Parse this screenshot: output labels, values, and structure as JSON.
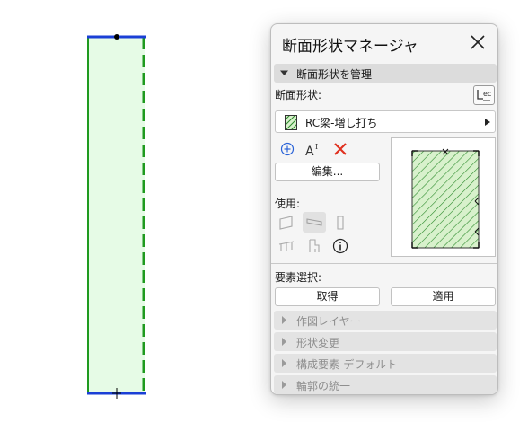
{
  "palette": {
    "title": "断面形状マネージャ",
    "sections": {
      "manage": "断面形状を管理",
      "layer": "作図レイヤー",
      "modify": "形状変更",
      "components": "構成要素-デフォルト",
      "outline": "輪郭の統一"
    },
    "profile_label": "断面形状:",
    "selected_profile": "RC梁-増し打ち",
    "edit_button": "編集...",
    "use_label": "使用:",
    "element_select_label": "要素選択:",
    "get_button": "取得",
    "apply_button": "適用"
  },
  "colors": {
    "accent_blue": "#1a3fd6",
    "green_line": "#1f9a1f",
    "fill_green": "#e6fbe6",
    "delete_red": "#e0301e"
  },
  "icons": [
    "close-icon",
    "browse-profiles-icon",
    "add-icon",
    "text-style-icon",
    "delete-icon",
    "wall-use-icon",
    "beam-use-icon",
    "column-use-icon",
    "railing-use-icon",
    "object-use-icon",
    "info-icon"
  ]
}
